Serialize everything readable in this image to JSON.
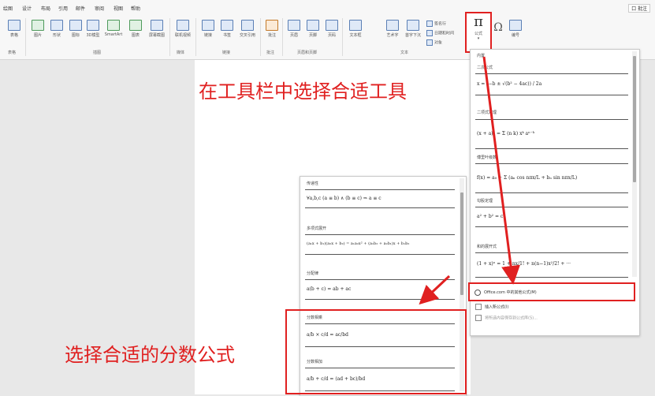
{
  "menubar": {
    "tabs": [
      "绘图",
      "设计",
      "布局",
      "引用",
      "邮件",
      "审阅",
      "视图",
      "帮助"
    ],
    "help_button": "口 批注"
  },
  "ribbon": {
    "buttons": [
      "表格",
      "图片",
      "形状",
      "图标",
      "3D模型",
      "SmartArt",
      "图表",
      "屏幕截图",
      "联机视频",
      "链接",
      "书签",
      "交叉引用",
      "批注",
      "页眉",
      "页脚",
      "页码",
      "文本框",
      "艺术字",
      "首字下沉"
    ],
    "small_items": [
      "签名行",
      "日期和时间",
      "对象"
    ],
    "groups": [
      "表格",
      "插图",
      "媒体",
      "链接",
      "批注",
      "页眉和页脚",
      "文本"
    ],
    "formula_label": "公式",
    "formula_symbol": "π",
    "omega_symbol": "Ω",
    "number_label": "编号"
  },
  "right_panel": {
    "header": "内置",
    "items": [
      {
        "title": "二次公式",
        "equation": "x = (−b ± √(b² − 4ac)) / 2a"
      },
      {
        "title": "二项式定理",
        "equation": "(x + a)ⁿ = Σ (n k) xᵏ aⁿ⁻ᵏ"
      },
      {
        "title": "傅里叶级数",
        "equation": "f(x) = a₀ + Σ (aₙ cos nπx/L + bₙ sin nπx/L)"
      },
      {
        "title": "勾股定理",
        "equation": "a² + b² = c²"
      },
      {
        "title": "和的展开式",
        "equation": "(1 + x)ⁿ = 1 + nx/1! + n(n−1)x²/2! + ···"
      }
    ],
    "office_link": "Office.com 中的其他公式(M)",
    "menu_items": [
      "插入新公式(I)",
      "将所选内容保存到公式库(S)..."
    ]
  },
  "left_panel": {
    "items": [
      {
        "title": "传递性",
        "equation": "∀a,b,c (a ≡ b) ∧ (b ≡ c) ⇒ a ≡ c"
      },
      {
        "title": "多项式展开",
        "equation": "(a₁x + b₁)(a₂x + b₂) = a₁a₂x² + (a₁b₂ + a₂b₁)x + b₁b₂"
      },
      {
        "title": "分配律",
        "equation": "a(b + c) = ab + ac"
      },
      {
        "title": "分数相乘",
        "equation": "a/b × c/d = ac/bd"
      },
      {
        "title": "分数相加",
        "equation": "a/b + c/d = (ad + bc)/bd"
      }
    ]
  },
  "captions": {
    "top": "在工具栏中选择合适工具",
    "bottom": "选择合适的分数公式"
  },
  "colors": {
    "accent": "#e02020"
  }
}
